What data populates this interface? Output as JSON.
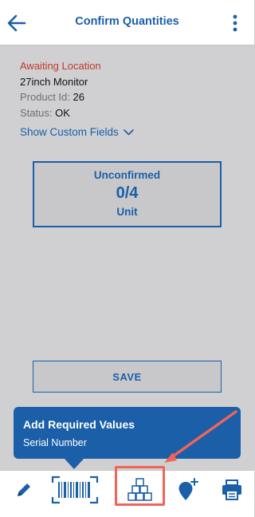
{
  "header": {
    "title": "Confirm Quantities",
    "back_icon": "arrow-left-icon",
    "menu_icon": "more-vertical-icon"
  },
  "item": {
    "status_line": "Awaiting Location",
    "name": "27inch Monitor",
    "product_id_label": "Product Id:",
    "product_id_value": "26",
    "status_label": "Status:",
    "status_value": "OK",
    "show_custom_fields": "Show Custom Fields"
  },
  "quantity": {
    "label": "Unconfirmed",
    "value": "0/4",
    "unit": "Unit"
  },
  "save_label": "SAVE",
  "tooltip": {
    "title": "Add Required Values",
    "subtitle": "Serial Number"
  },
  "tabbar": {
    "items": [
      {
        "icon": "pencil-icon"
      },
      {
        "icon": "barcode-scan-icon"
      },
      {
        "icon": "stacked-boxes-icon",
        "highlighted": true
      },
      {
        "icon": "add-location-icon"
      },
      {
        "icon": "printer-icon"
      }
    ]
  },
  "colors": {
    "brand": "#1a5fa8",
    "alert": "#c0392b",
    "annotation": "#f0645a",
    "background": "#d0d0d2"
  }
}
